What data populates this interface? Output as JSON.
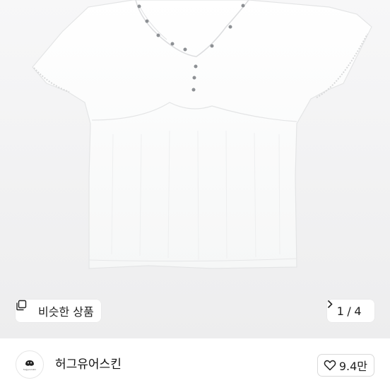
{
  "product": {
    "image_label": "product-photo"
  },
  "similar": {
    "label": "비슷한 상품",
    "icon": "copy-icon"
  },
  "pager": {
    "current": "1",
    "separator": "/",
    "total": "4",
    "icon": "chevron-right-icon"
  },
  "seller": {
    "name": "허그유어스킨",
    "avatar_text": "hugyourskin"
  },
  "like": {
    "count": "9.4만",
    "icon": "heart-outline-icon"
  },
  "colors": {
    "image_bg": "#f2f2f3",
    "chip_bg": "#ffffff",
    "text": "#222222",
    "border": "#d9d9d9"
  }
}
